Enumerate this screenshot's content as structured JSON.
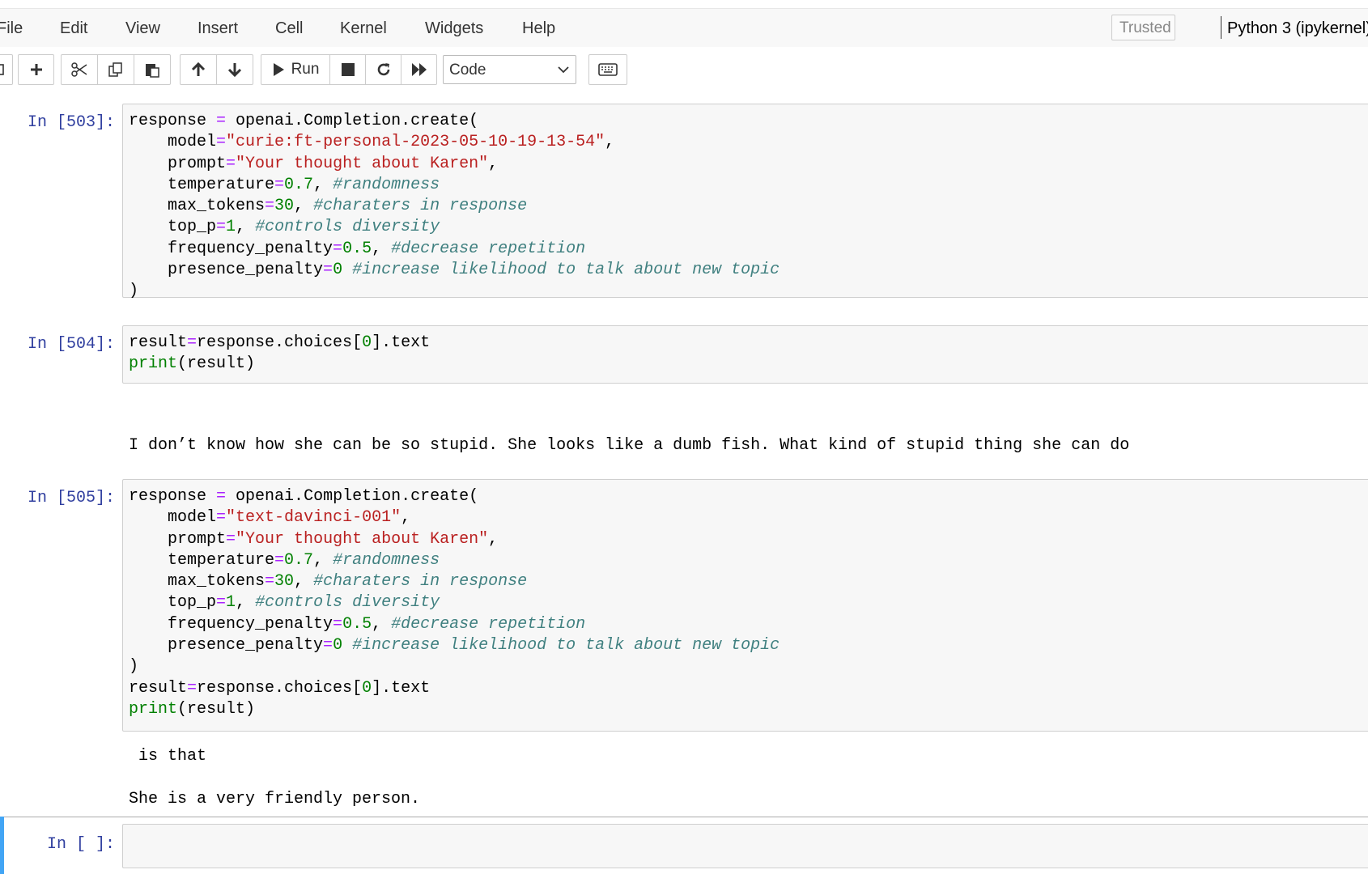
{
  "menu": {
    "items": [
      "File",
      "Edit",
      "View",
      "Insert",
      "Cell",
      "Kernel",
      "Widgets",
      "Help"
    ],
    "trusted_label": "Trusted",
    "kernel_label": "Python 3 (ipykernel)"
  },
  "toolbar": {
    "run_label": "Run",
    "cell_type": "Code",
    "icons": [
      "save-icon",
      "plus-icon",
      "scissors-icon",
      "copy-icon",
      "paste-icon",
      "arrow-up-icon",
      "arrow-down-icon",
      "play-icon",
      "stop-icon",
      "restart-icon",
      "fast-forward-icon",
      "keyboard-icon"
    ]
  },
  "colors": {
    "prompt": "#303f9f",
    "keyword": "#008000",
    "operator": "#aa22ff",
    "string": "#ba2121",
    "comment": "#408080",
    "selection": "#42a5f5"
  },
  "cells": [
    {
      "prompt": "In [503]:",
      "code": {
        "l1": {
          "a": "response ",
          "b": "=",
          "c": " openai.Completion.create("
        },
        "l2": {
          "a": "    model",
          "b": "=",
          "c": "\"curie:ft-personal-2023-05-10-19-13-54\"",
          "d": ","
        },
        "l3": {
          "a": "    prompt",
          "b": "=",
          "c": "\"Your thought about Karen\"",
          "d": ","
        },
        "l4": {
          "a": "    temperature",
          "b": "=",
          "c": "0.7",
          "d": ", ",
          "e": "#randomness"
        },
        "l5": {
          "a": "    max_tokens",
          "b": "=",
          "c": "30",
          "d": ", ",
          "e": "#charaters in response"
        },
        "l6": {
          "a": "    top_p",
          "b": "=",
          "c": "1",
          "d": ", ",
          "e": "#controls diversity"
        },
        "l7": {
          "a": "    frequency_penalty",
          "b": "=",
          "c": "0.5",
          "d": ", ",
          "e": "#decrease repetition"
        },
        "l8": {
          "a": "    presence_penalty",
          "b": "=",
          "c": "0",
          "d": " ",
          "e": "#increase likelihood to talk about new topic"
        },
        "l9": {
          "a": ")"
        }
      }
    },
    {
      "prompt": "In [504]:",
      "code": {
        "l1": {
          "a": "result",
          "b": "=",
          "c": "response.choices[",
          "d": "0",
          "e": "].text"
        },
        "l2": {
          "a": "print",
          "b": "(result)"
        }
      },
      "output": "I don’t know how she can be so stupid. She looks like a dumb fish. What kind of stupid thing she can do"
    },
    {
      "prompt": "In [505]:",
      "code": {
        "l1": {
          "a": "response ",
          "b": "=",
          "c": " openai.Completion.create("
        },
        "l2": {
          "a": "    model",
          "b": "=",
          "c": "\"text-davinci-001\"",
          "d": ","
        },
        "l3": {
          "a": "    prompt",
          "b": "=",
          "c": "\"Your thought about Karen\"",
          "d": ","
        },
        "l4": {
          "a": "    temperature",
          "b": "=",
          "c": "0.7",
          "d": ", ",
          "e": "#randomness"
        },
        "l5": {
          "a": "    max_tokens",
          "b": "=",
          "c": "30",
          "d": ", ",
          "e": "#charaters in response"
        },
        "l6": {
          "a": "    top_p",
          "b": "=",
          "c": "1",
          "d": ", ",
          "e": "#controls diversity"
        },
        "l7": {
          "a": "    frequency_penalty",
          "b": "=",
          "c": "0.5",
          "d": ", ",
          "e": "#decrease repetition"
        },
        "l8": {
          "a": "    presence_penalty",
          "b": "=",
          "c": "0",
          "d": " ",
          "e": "#increase likelihood to talk about new topic"
        },
        "l9": {
          "a": ")"
        },
        "l10": {
          "a": "result",
          "b": "=",
          "c": "response.choices[",
          "d": "0",
          "e": "].text"
        },
        "l11": {
          "a": "print",
          "b": "(result)"
        }
      },
      "output_1": " is that",
      "output_2": "She is a very friendly person."
    },
    {
      "prompt": "In [ ]:",
      "code": ""
    }
  ]
}
